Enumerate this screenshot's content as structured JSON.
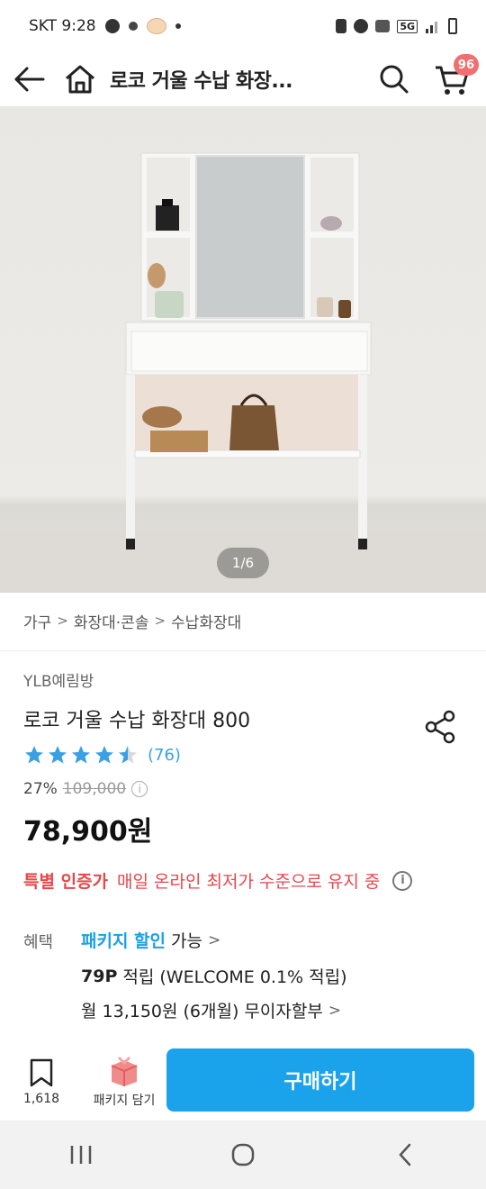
{
  "status_bar": {
    "carrier_time": "SKT 9:28",
    "network": "5G"
  },
  "header": {
    "title": "로코 거울 수납 화장...",
    "cart_count": "96"
  },
  "image": {
    "counter": "1/6"
  },
  "breadcrumb": [
    "가구",
    "화장대·콘솔",
    "수납화장대"
  ],
  "product": {
    "brand": "YLB예림방",
    "title": "로코 거울 수납 화장대 800",
    "rating": 4.5,
    "review_count": "(76)",
    "discount": "27%",
    "original_price": "109,000",
    "final_price": "78,900원"
  },
  "certification": {
    "tag": "특별 인증가",
    "text": "매일 온라인 최저가 수준으로 유지 중"
  },
  "benefits": {
    "label": "혜택",
    "package_discount": "패키지 할인",
    "package_available": "가능",
    "points": "79P",
    "points_text": "적립 (WELCOME 0.1% 적립)",
    "installment": "월 13,150원 (6개월) 무이자할부"
  },
  "bottom_bar": {
    "wish_count": "1,618",
    "package_label": "패키지 담기",
    "buy_label": "구매하기"
  },
  "colors": {
    "accent_blue": "#1aa3ea",
    "star_blue": "#3aa0e4",
    "cert_red": "#e8474a",
    "cart_badge": "#f26f6f"
  }
}
